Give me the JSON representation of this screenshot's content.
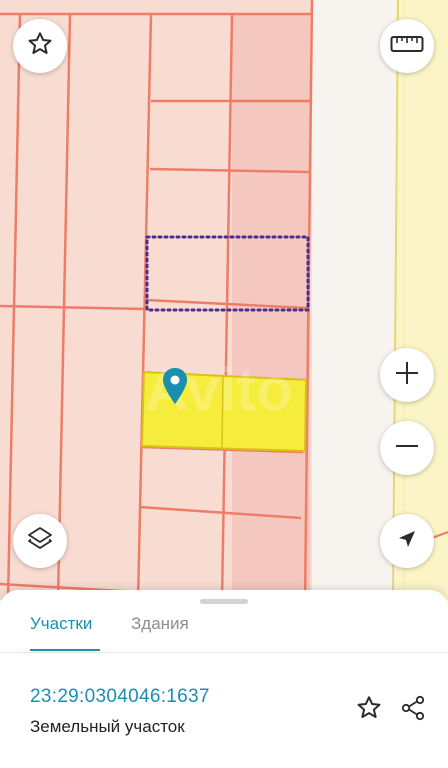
{
  "map": {
    "watermark": "Avito",
    "colors": {
      "parcel_fill": "#f8dcd2",
      "parcel_fill_dark": "#f4c7bf",
      "parcel_border": "#ee7d68",
      "road": "#f7f4ef",
      "zone_fill": "#fbf4c6",
      "zone_border": "#e6d776",
      "selected_fill": "#f6ec3c",
      "selected_border": "#d8c21a",
      "dotted_border": "#4a2d8e",
      "pin": "#1a8fb0"
    },
    "controls": {
      "favorite_icon": "star-outline-icon",
      "ruler_icon": "ruler-icon",
      "zoom_in_icon": "plus-icon",
      "zoom_out_icon": "minus-icon",
      "layers_icon": "layers-icon",
      "locate_icon": "navigation-arrow-icon"
    }
  },
  "sheet": {
    "tabs": [
      {
        "label": "Участки",
        "active": true
      },
      {
        "label": "Здания",
        "active": false
      }
    ],
    "parcel": {
      "cadastral_number": "23:29:0304046:1637",
      "type": "Земельный участок"
    },
    "actions": {
      "favorite_icon": "star-outline-icon",
      "share_icon": "share-icon"
    },
    "accent_color": "#1a8fb0"
  }
}
